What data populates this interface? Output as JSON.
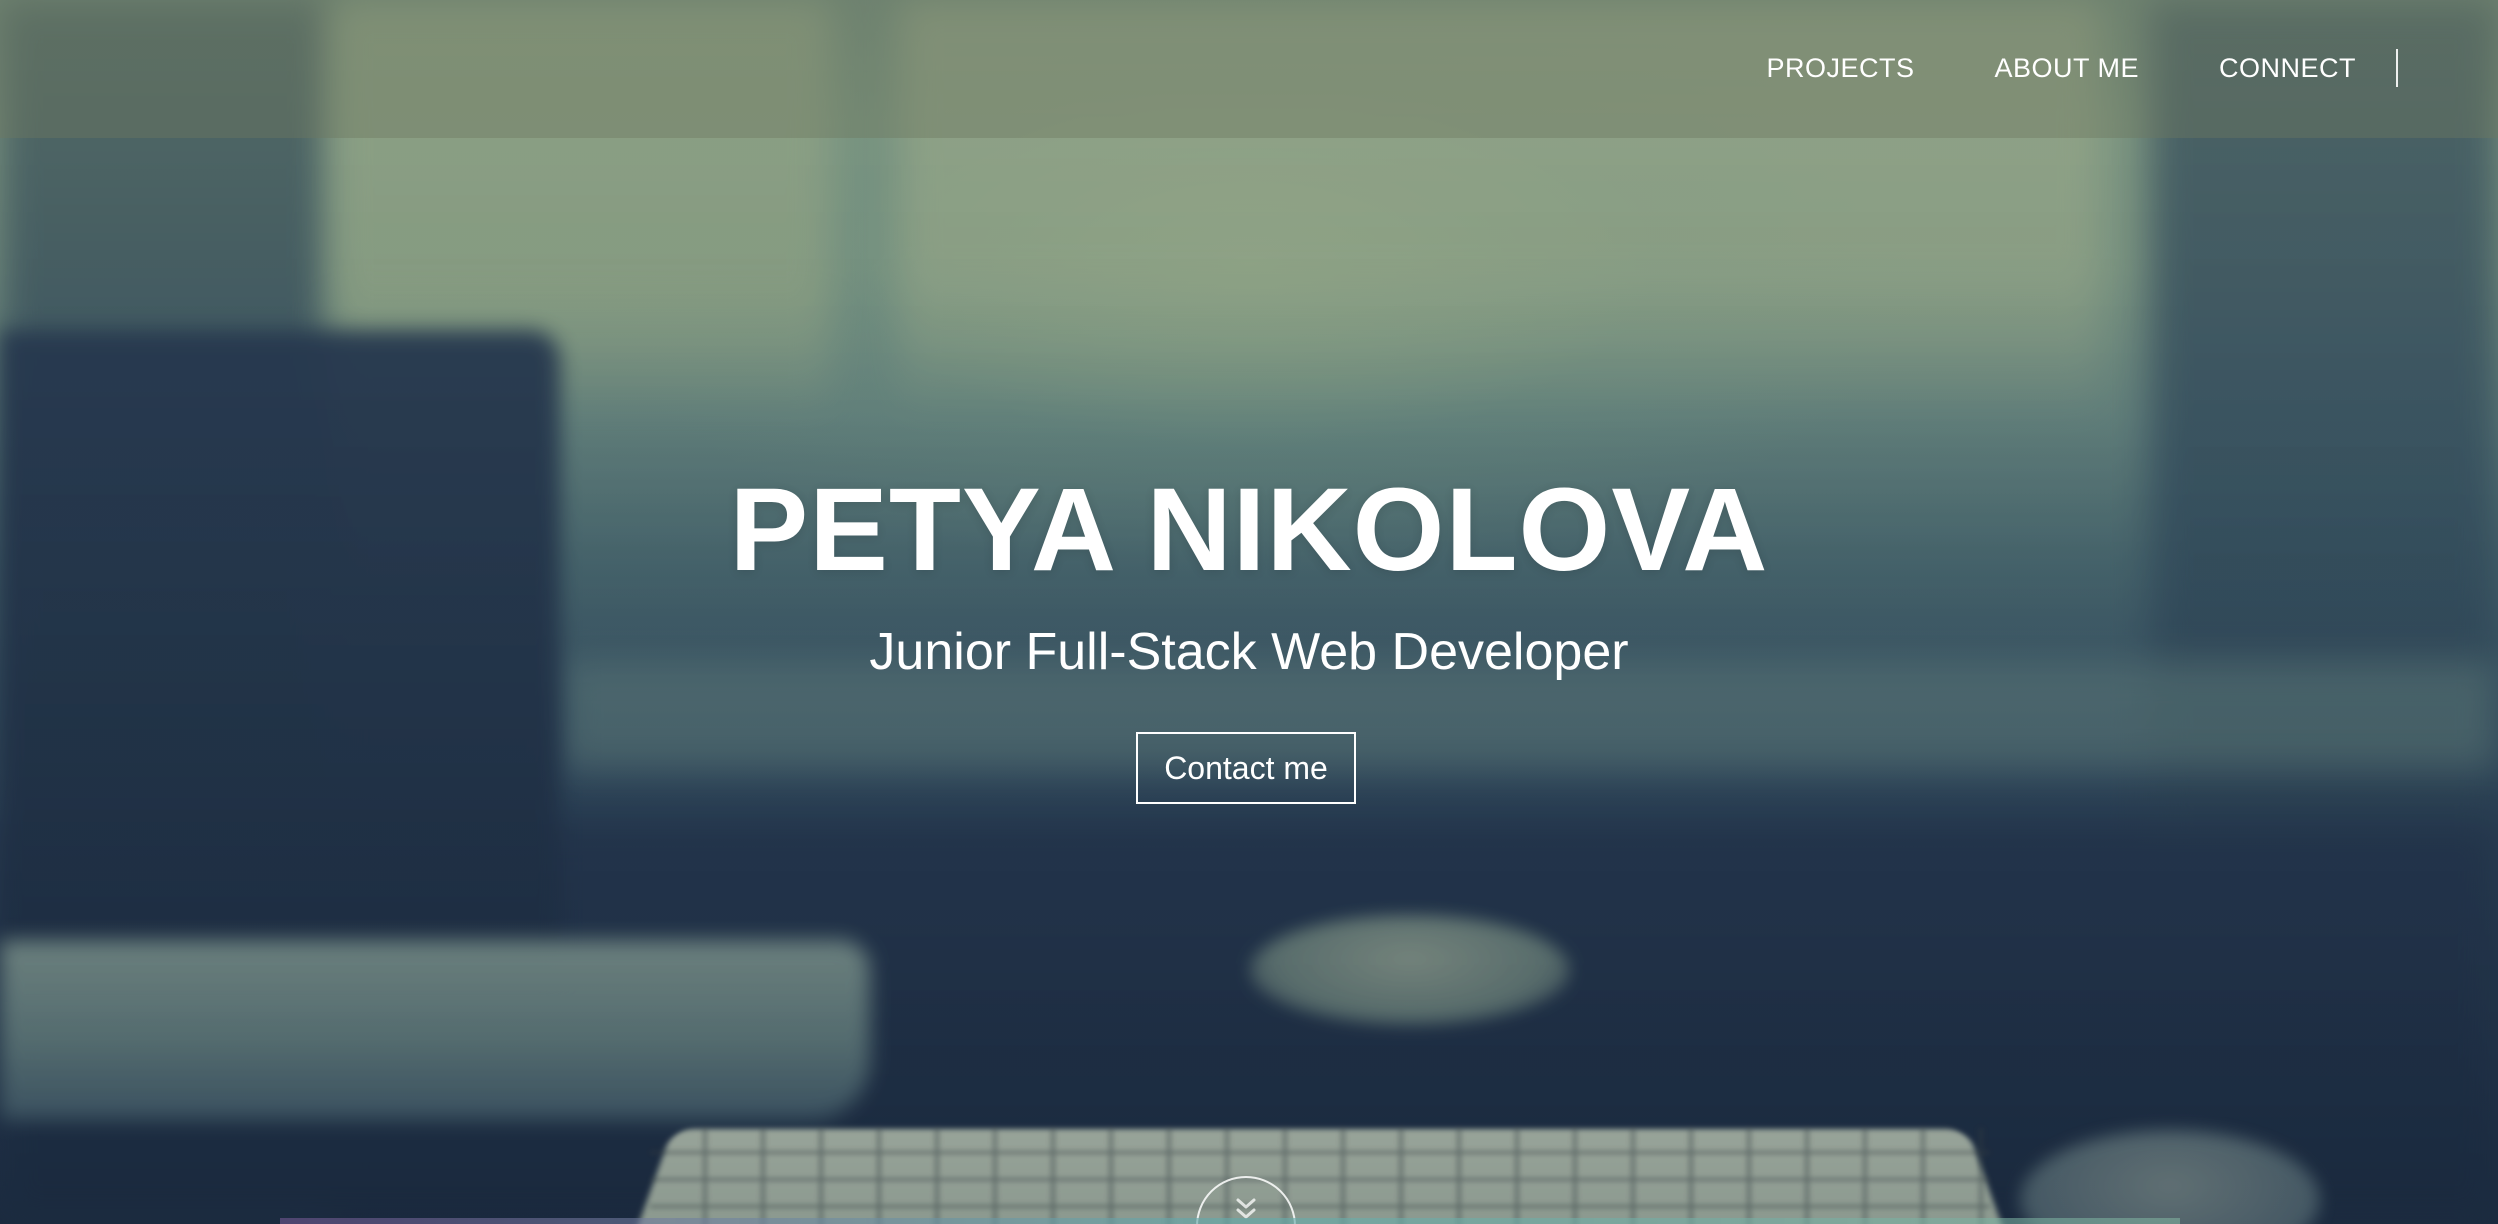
{
  "nav": {
    "links": [
      {
        "label": "PROJECTS"
      },
      {
        "label": "ABOUT ME"
      },
      {
        "label": "CONNECT"
      }
    ]
  },
  "hero": {
    "title": "PETYA NIKOLOVA",
    "subtitle": "Junior Full-Stack Web Developer",
    "cta_label": "Contact me",
    "scroll_icon": "chevron-double-down-icon"
  },
  "colors": {
    "text": "#ffffff",
    "navbar_bg": "rgba(110,120,95,0.42)",
    "hero_dark": "#1d2b3e",
    "hero_light": "#8ea88c"
  }
}
